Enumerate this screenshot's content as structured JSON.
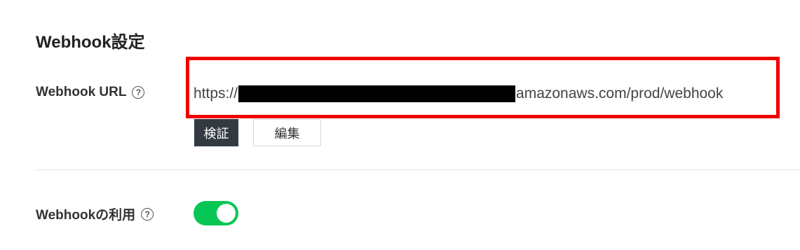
{
  "section": {
    "title": "Webhook設定"
  },
  "webhook_url": {
    "label": "Webhook URL",
    "help_icon": "question-circle-icon",
    "url_prefix": "https://",
    "url_suffix": "amazonaws.com/prod/webhook",
    "verify_button": "検証",
    "edit_button": "編集"
  },
  "webhook_usage": {
    "label": "Webhookの利用",
    "help_icon": "question-circle-icon",
    "enabled": true
  },
  "colors": {
    "highlight_box": "#ee0000",
    "toggle_on": "#06c755",
    "verify_button_bg": "#333a42"
  }
}
